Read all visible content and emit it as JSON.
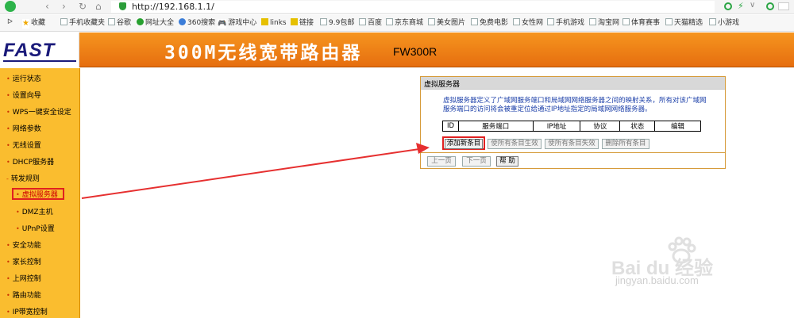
{
  "browser": {
    "url": "http://192.168.1.1/",
    "back_glyph": "‹",
    "forward_glyph": "›",
    "reload_glyph": "↻",
    "home_glyph": "⌂",
    "ext_bolt_glyph": "⚡",
    "ext_dropdown_glyph": "∨"
  },
  "bookmarks": {
    "collapse_glyph": "ᐅ",
    "items": [
      {
        "label": "收藏",
        "icon": "star-icon"
      },
      {
        "label": "手机收藏夹",
        "icon": "page-icon"
      },
      {
        "label": "谷歌",
        "icon": "page-icon"
      },
      {
        "label": "网址大全",
        "icon": "check-icon"
      },
      {
        "label": "360搜索",
        "icon": "blue-icon"
      },
      {
        "label": "游戏中心",
        "icon": "gamepad-icon"
      },
      {
        "label": "links",
        "icon": "folder-icon"
      },
      {
        "label": "链接",
        "icon": "folder-icon"
      },
      {
        "label": "9.9包邮",
        "icon": "page-icon"
      },
      {
        "label": "百度",
        "icon": "page-icon"
      },
      {
        "label": "京东商城",
        "icon": "page-icon"
      },
      {
        "label": "美女图片",
        "icon": "page-icon"
      },
      {
        "label": "免费电影",
        "icon": "page-icon"
      },
      {
        "label": "女性网",
        "icon": "page-icon"
      },
      {
        "label": "手机游戏",
        "icon": "page-icon"
      },
      {
        "label": "淘宝网",
        "icon": "page-icon"
      },
      {
        "label": "体育赛事",
        "icon": "page-icon"
      },
      {
        "label": "天猫精选",
        "icon": "page-icon"
      },
      {
        "label": "小游戏",
        "icon": "page-icon"
      }
    ]
  },
  "banner": {
    "brand": "FAST",
    "product": "300M无线宽带路由器",
    "model": "FW300R",
    "colors": {
      "banner": "#f0841a",
      "brand": "#1a1a7a"
    }
  },
  "sidebar": {
    "bullet": "•",
    "collapse_bullet": "-",
    "items": [
      {
        "label": "运行状态"
      },
      {
        "label": "设置向导"
      },
      {
        "label": "WPS一键安全设定"
      },
      {
        "label": "网络参数"
      },
      {
        "label": "无线设置"
      },
      {
        "label": "DHCP服务器"
      },
      {
        "label": "转发规则"
      },
      {
        "label": "虚拟服务器",
        "selected": true
      },
      {
        "label": "DMZ主机"
      },
      {
        "label": "UPnP设置"
      },
      {
        "label": "安全功能"
      },
      {
        "label": "家长控制"
      },
      {
        "label": "上网控制"
      },
      {
        "label": "路由功能"
      },
      {
        "label": "IP带宽控制"
      }
    ]
  },
  "panel": {
    "title": "虚拟服务器",
    "description": "虚拟服务器定义了广域网服务端口和局域网网络服务器之间的映射关系，所有对该广域网服务端口的访问将会被重定位给通过IP地址指定的局域网网络服务器。",
    "table_headers": [
      "ID",
      "服务端口",
      "IP地址",
      "协议",
      "状态",
      "编辑"
    ],
    "buttons": {
      "add": "添加新条目",
      "enable_all": "使所有条目生效",
      "disable_all": "使所有条目失效",
      "delete_all": "删除所有条目",
      "prev": "上一页",
      "next": "下一页",
      "help": "帮 助"
    }
  },
  "watermark": {
    "text": "Bai du 经验",
    "sub": "jingyan.baidu.com"
  }
}
